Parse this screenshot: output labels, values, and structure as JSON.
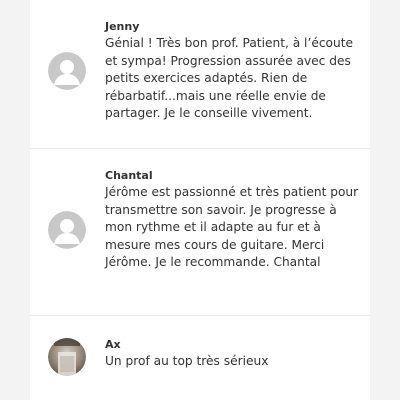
{
  "reviews": [
    {
      "name": "Jenny",
      "text": "Génial ! Très bon prof. Patient, à l’écoute et sympa! Progression assurée avec des petits exercices adaptés. Rien de rébarbatif...mais une réelle envie de partager. Je le conseille vivement.",
      "avatar": "default-user-icon"
    },
    {
      "name": "Chantal",
      "text": "Jérôme est passionné et très patient pour transmettre son savoir. Je progresse à mon rythme et il adapte au fur et à mesure mes cours de guitare. Merci Jérôme. Je le recommande. Chantal",
      "avatar": "default-user-icon"
    },
    {
      "name": "Ax",
      "text": "Un prof au top très sérieux",
      "avatar": "user-photo"
    }
  ],
  "colors": {
    "background": "#f3f3f3",
    "card": "#ffffff",
    "avatar_default": "#c8c8c8",
    "text": "#333333"
  }
}
